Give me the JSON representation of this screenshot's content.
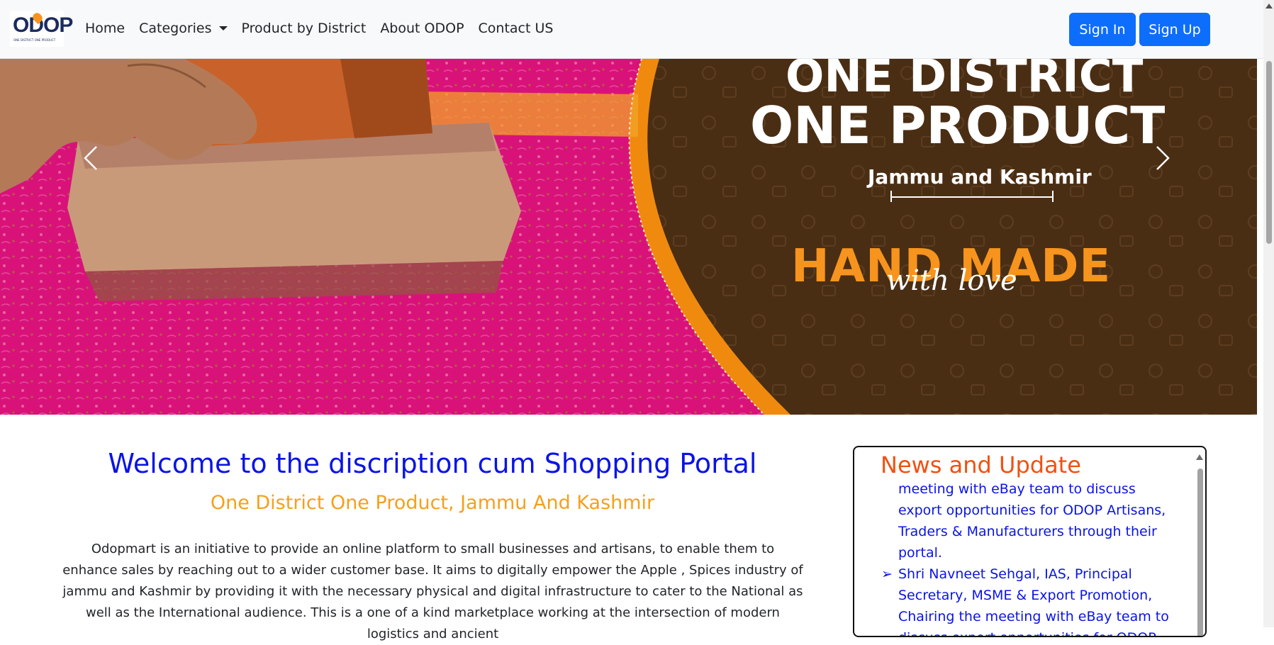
{
  "navbar": {
    "logo_text": "ODOP",
    "logo_sub": "ONE DISTRICT ONE PRODUCT",
    "links": [
      "Home",
      "Categories",
      "Product by District",
      "About ODOP",
      "Contact US"
    ],
    "sign_in": "Sign In",
    "sign_up": "Sign Up"
  },
  "hero": {
    "line1": "ONE DISTRICT",
    "line2": "ONE PRODUCT",
    "region": "Jammu and Kashmir",
    "handmade": "HAND MADE",
    "with_love": "with love",
    "prev_icon": "chevron-left-icon",
    "next_icon": "chevron-right-icon"
  },
  "welcome": {
    "title": "Welcome to the discription cum Shopping Portal",
    "subtitle": "One District One Product, Jammu And Kashmir",
    "body": "Odopmart is an initiative to provide an online platform to small businesses and artisans, to enable them to enhance sales by reaching out to a wider customer base. It aims to digitally empower the Apple , Spices industry of jammu and Kashmir by providing it with the necessary physical and digital infrastructure to cater to the National as well as the International audience. This is a one of a kind marketplace working at the intersection of modern logistics and ancient"
  },
  "news": {
    "title": "News and Update",
    "items": [
      "meeting with eBay team to discuss export opportunities for ODOP Artisans, Traders & Manufacturers through their portal.",
      "Shri Navneet Sehgal, IAS, Principal Secretary, MSME & Export Promotion, Chairing the meeting with eBay team to discuss export opportunities for ODOP Artisans, Traders &"
    ],
    "bullet": "➢"
  },
  "colors": {
    "primary": "#0d6efd",
    "welcome_title": "#0a14e6",
    "welcome_sub": "#f6a01a",
    "news_title": "#f25011",
    "hero_brown": "#4a2e14",
    "hero_orange": "#f7941d",
    "hero_pink": "#d9127a"
  }
}
